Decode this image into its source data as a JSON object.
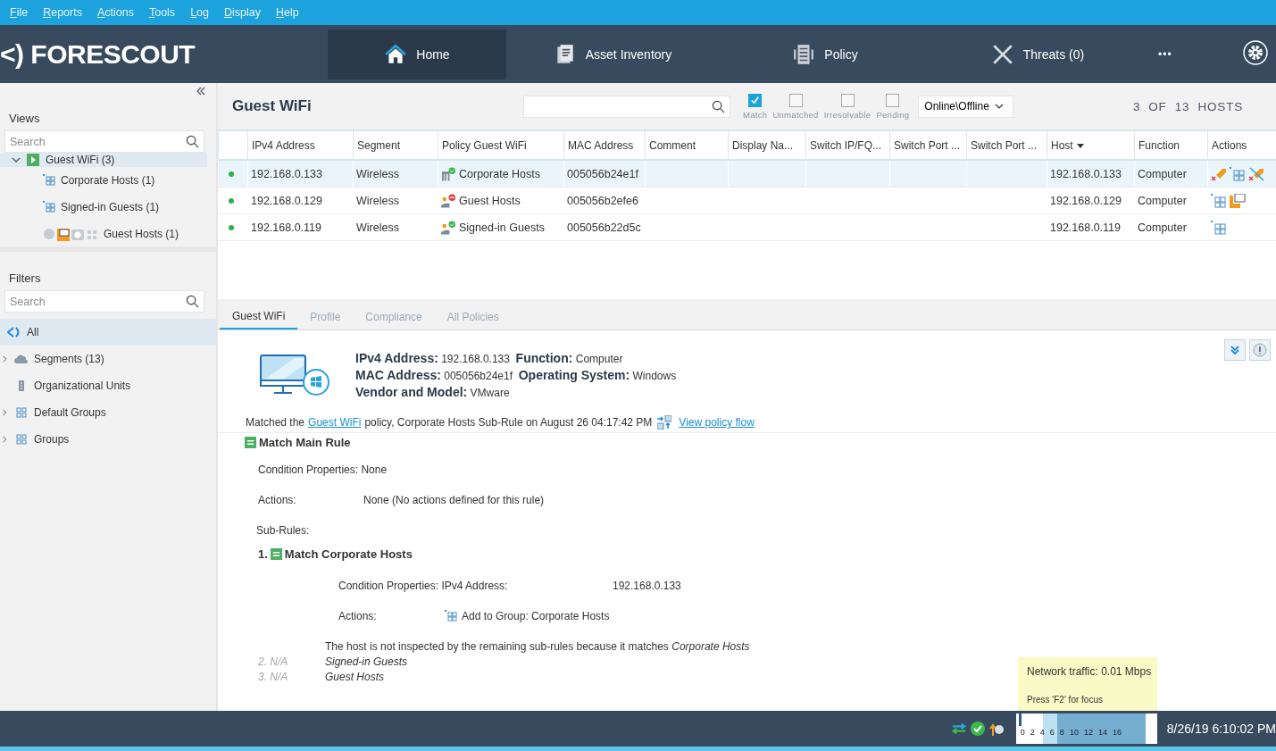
{
  "menu": [
    {
      "label": "File"
    },
    {
      "label": "Reports"
    },
    {
      "label": "Actions"
    },
    {
      "label": "Tools"
    },
    {
      "label": "Log"
    },
    {
      "label": "Display"
    },
    {
      "label": "Help"
    }
  ],
  "header": {
    "logo": "<) FORESCOUT",
    "tabs": [
      {
        "label": "Home",
        "kind": "home",
        "selected": true
      },
      {
        "label": "Asset Inventory",
        "kind": "inventory",
        "selected": false
      },
      {
        "label": "Policy",
        "kind": "policy",
        "selected": false
      },
      {
        "label": "Threats (0)",
        "kind": "threats",
        "selected": false
      }
    ],
    "more": "•••"
  },
  "views": {
    "title": "Views",
    "search": {
      "placeholder": "Search"
    },
    "tree": [
      {
        "label": "Guest WiFi (3)",
        "expanded": true,
        "selected": true,
        "children": [
          {
            "label": "Corporate Hosts (1)",
            "kind": "group",
            "selected": false
          },
          {
            "label": "Signed-in Guests (1)",
            "kind": "group",
            "selected": false
          },
          {
            "label": "Guest Hosts (1)",
            "kind": "multi",
            "selected": false
          }
        ]
      }
    ]
  },
  "filters": {
    "title": "Filters",
    "search": {
      "placeholder": "Search"
    },
    "items": [
      {
        "label": "All",
        "kind": "logo",
        "expandable": false,
        "selected": true
      },
      {
        "label": "Segments (13)",
        "kind": "cloud",
        "expandable": true,
        "selected": false
      },
      {
        "label": "Organizational Units",
        "kind": "building",
        "expandable": false,
        "selected": false
      },
      {
        "label": "Default Groups",
        "kind": "group",
        "expandable": true,
        "selected": false
      },
      {
        "label": "Groups",
        "kind": "group",
        "expandable": true,
        "selected": false
      }
    ]
  },
  "hosts": {
    "title": "Guest WiFi",
    "checks": [
      {
        "label": "Match",
        "checked": true
      },
      {
        "label": "Unmatched",
        "checked": false
      },
      {
        "label": "Irresolvable",
        "checked": false
      },
      {
        "label": "Pending",
        "checked": false
      }
    ],
    "dropdown": "Online\\Offline",
    "count": "3  OF  13  HOSTS",
    "columns": [
      {
        "label": "IPv4 Address",
        "sorted": false
      },
      {
        "label": "Segment",
        "sorted": false
      },
      {
        "label": "Policy Guest WiFi",
        "sorted": false
      },
      {
        "label": "MAC Address",
        "sorted": false
      },
      {
        "label": "Comment",
        "sorted": false
      },
      {
        "label": "Display Na...",
        "sorted": false
      },
      {
        "label": "Switch IP/FQ...",
        "sorted": false
      },
      {
        "label": "Switch Port ...",
        "sorted": false
      },
      {
        "label": "Switch Port ...",
        "sorted": false
      },
      {
        "label": "Host",
        "sorted": true
      },
      {
        "label": "Function",
        "sorted": false
      },
      {
        "label": "Actions",
        "sorted": false
      }
    ],
    "rows": [
      {
        "online": true,
        "selected": true,
        "ip": "192.168.0.133",
        "segment": "Wireless",
        "policy": {
          "kind": "corporate-ok",
          "label": "Corporate Hosts"
        },
        "mac": "005056b24e1f",
        "host": "192.168.0.133",
        "function": "Computer",
        "actions": [
          {
            "kind": "tag"
          },
          {
            "kind": "group"
          },
          {
            "kind": "untag"
          }
        ]
      },
      {
        "online": true,
        "selected": false,
        "ip": "192.168.0.129",
        "segment": "Wireless",
        "policy": {
          "kind": "guest-blocked",
          "label": "Guest Hosts"
        },
        "mac": "005056b2efe6",
        "host": "192.168.0.129",
        "function": "Computer",
        "actions": [
          {
            "kind": "group"
          },
          {
            "kind": "network"
          }
        ]
      },
      {
        "online": true,
        "selected": false,
        "ip": "192.168.0.119",
        "segment": "Wireless",
        "policy": {
          "kind": "guest-ok",
          "label": "Signed-in Guests"
        },
        "mac": "005056b22d5c",
        "host": "192.168.0.119",
        "function": "Computer",
        "actions": [
          {
            "kind": "group"
          }
        ]
      }
    ]
  },
  "details": {
    "tabs": [
      {
        "label": "Guest WiFi",
        "selected": true
      },
      {
        "label": "Profile",
        "selected": false
      },
      {
        "label": "Compliance",
        "selected": false
      },
      {
        "label": "All Policies",
        "selected": false
      }
    ],
    "info": [
      "**IPv4 Address:** 192.168.0.133  **Function:** Computer",
      "**MAC Address:** 005056b24e1f  **Operating System:** Windows",
      "**Vendor and Model:** VMware"
    ],
    "matched_before": "Matched the",
    "matched_link": "Guest WiFi",
    "matched_after": "policy, Corporate Hosts Sub-Rule on August 26 04:17:42 PM",
    "flow_link": "View policy flow",
    "main_rule": "Match  Main Rule",
    "condition": "Condition Properties: None",
    "actions_label": "Actions:",
    "actions_value": "None (No actions defined for this rule)",
    "subrules_label": "Sub-Rules:",
    "subrule": {
      "number": "1.",
      "title": "Match Corporate Hosts",
      "condition_label": "Condition Properties: IPv4 Address:",
      "condition_value": "192.168.0.133",
      "actions_label": "Actions:",
      "action": "Add to Group: Corporate Hosts"
    },
    "note": "The host is not inspected by the remaining sub-rules because it matches *Corporate Hosts*",
    "skipped": [
      {
        "number": "2. N/A",
        "name": "Signed-in Guests"
      },
      {
        "number": "3. N/A",
        "name": "Guest Hosts"
      }
    ]
  },
  "tooltip": [
    "Network traffic: 0.01 Mbps",
    "Press 'F2' for focus"
  ],
  "status": {
    "meter_ticks": [
      "0",
      "2",
      "4",
      "6",
      "8",
      "10",
      "12",
      "14",
      "16"
    ],
    "level": 0.02,
    "datetime": "8/26/19 6:10:02 PM"
  }
}
